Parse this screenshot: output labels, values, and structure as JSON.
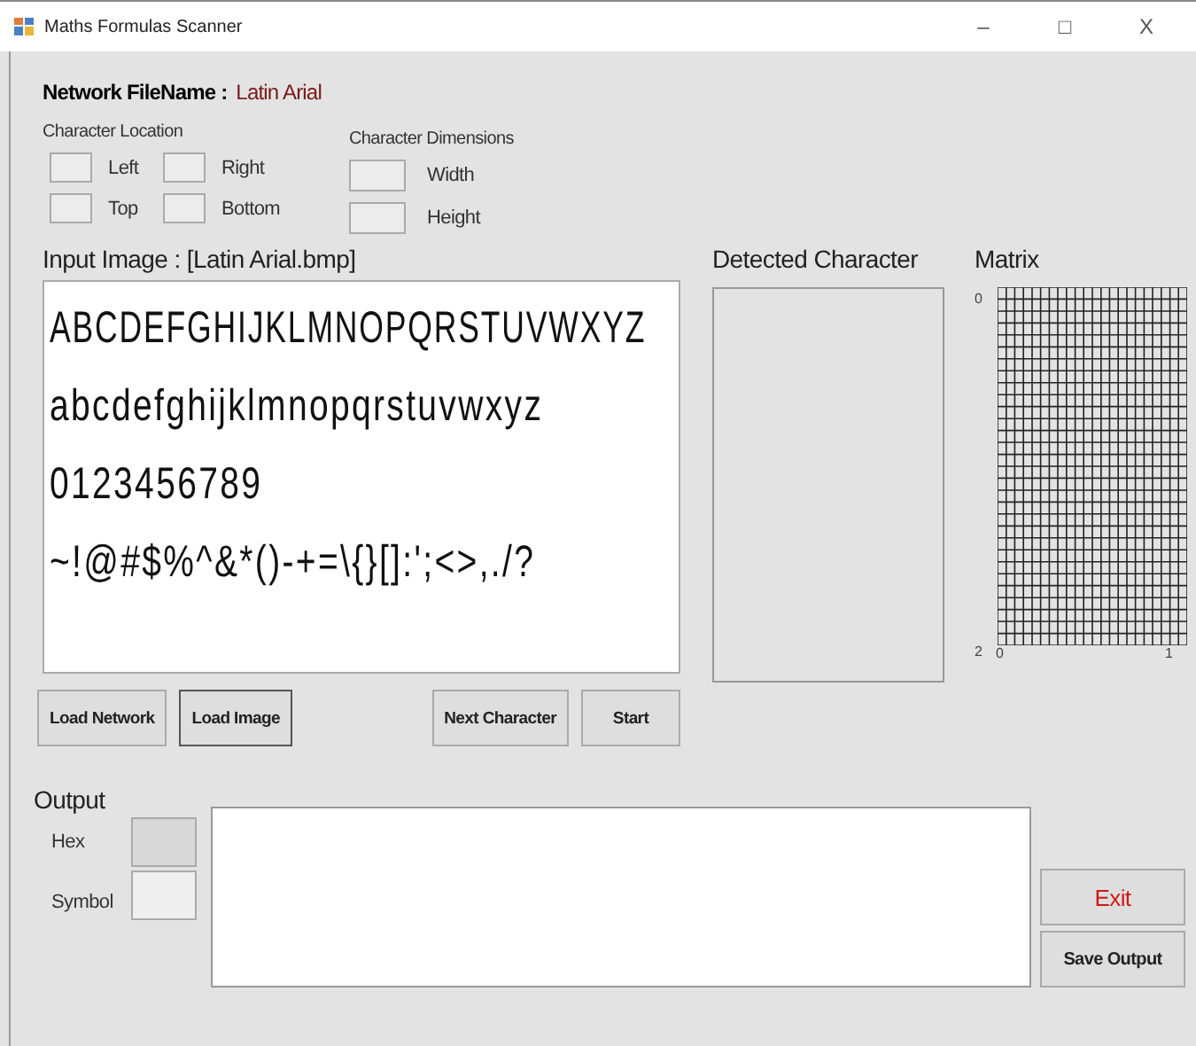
{
  "window": {
    "title": "Maths Formulas Scanner",
    "controls": [
      "–",
      "□",
      "X"
    ]
  },
  "network": {
    "label": "Network FileName :",
    "value": "Latin Arial"
  },
  "character_location": {
    "title": "Character Location",
    "fields": [
      {
        "label": "Left"
      },
      {
        "label": "Right"
      },
      {
        "label": "Top"
      },
      {
        "label": "Bottom"
      }
    ]
  },
  "character_dimensions": {
    "title": "Character Dimensions",
    "fields": [
      {
        "label": "Width"
      },
      {
        "label": "Height"
      }
    ]
  },
  "input_image": {
    "title": "Input Image : [Latin Arial.bmp]",
    "lines": [
      "ABCDEFGHIJKLMNOPQRSTUVWXYZ",
      "abcdefghijklmnopqrstuvwxyz",
      "0123456789",
      "~!@#$%^&*()-+=\\{}[]:';<>,./?"
    ]
  },
  "detected_character": {
    "title": "Detected Character"
  },
  "matrix": {
    "title": "Matrix",
    "y_labels": [
      "0",
      "2"
    ],
    "x_labels": [
      "0",
      "1"
    ]
  },
  "buttons_left": [
    "Load Network",
    "Load Image"
  ],
  "buttons_right": [
    "Next Character",
    "Start"
  ],
  "output": {
    "title": "Output",
    "hex_label": "Hex",
    "symbol_label": "Symbol",
    "exit": "Exit",
    "save": "Save Output"
  }
}
